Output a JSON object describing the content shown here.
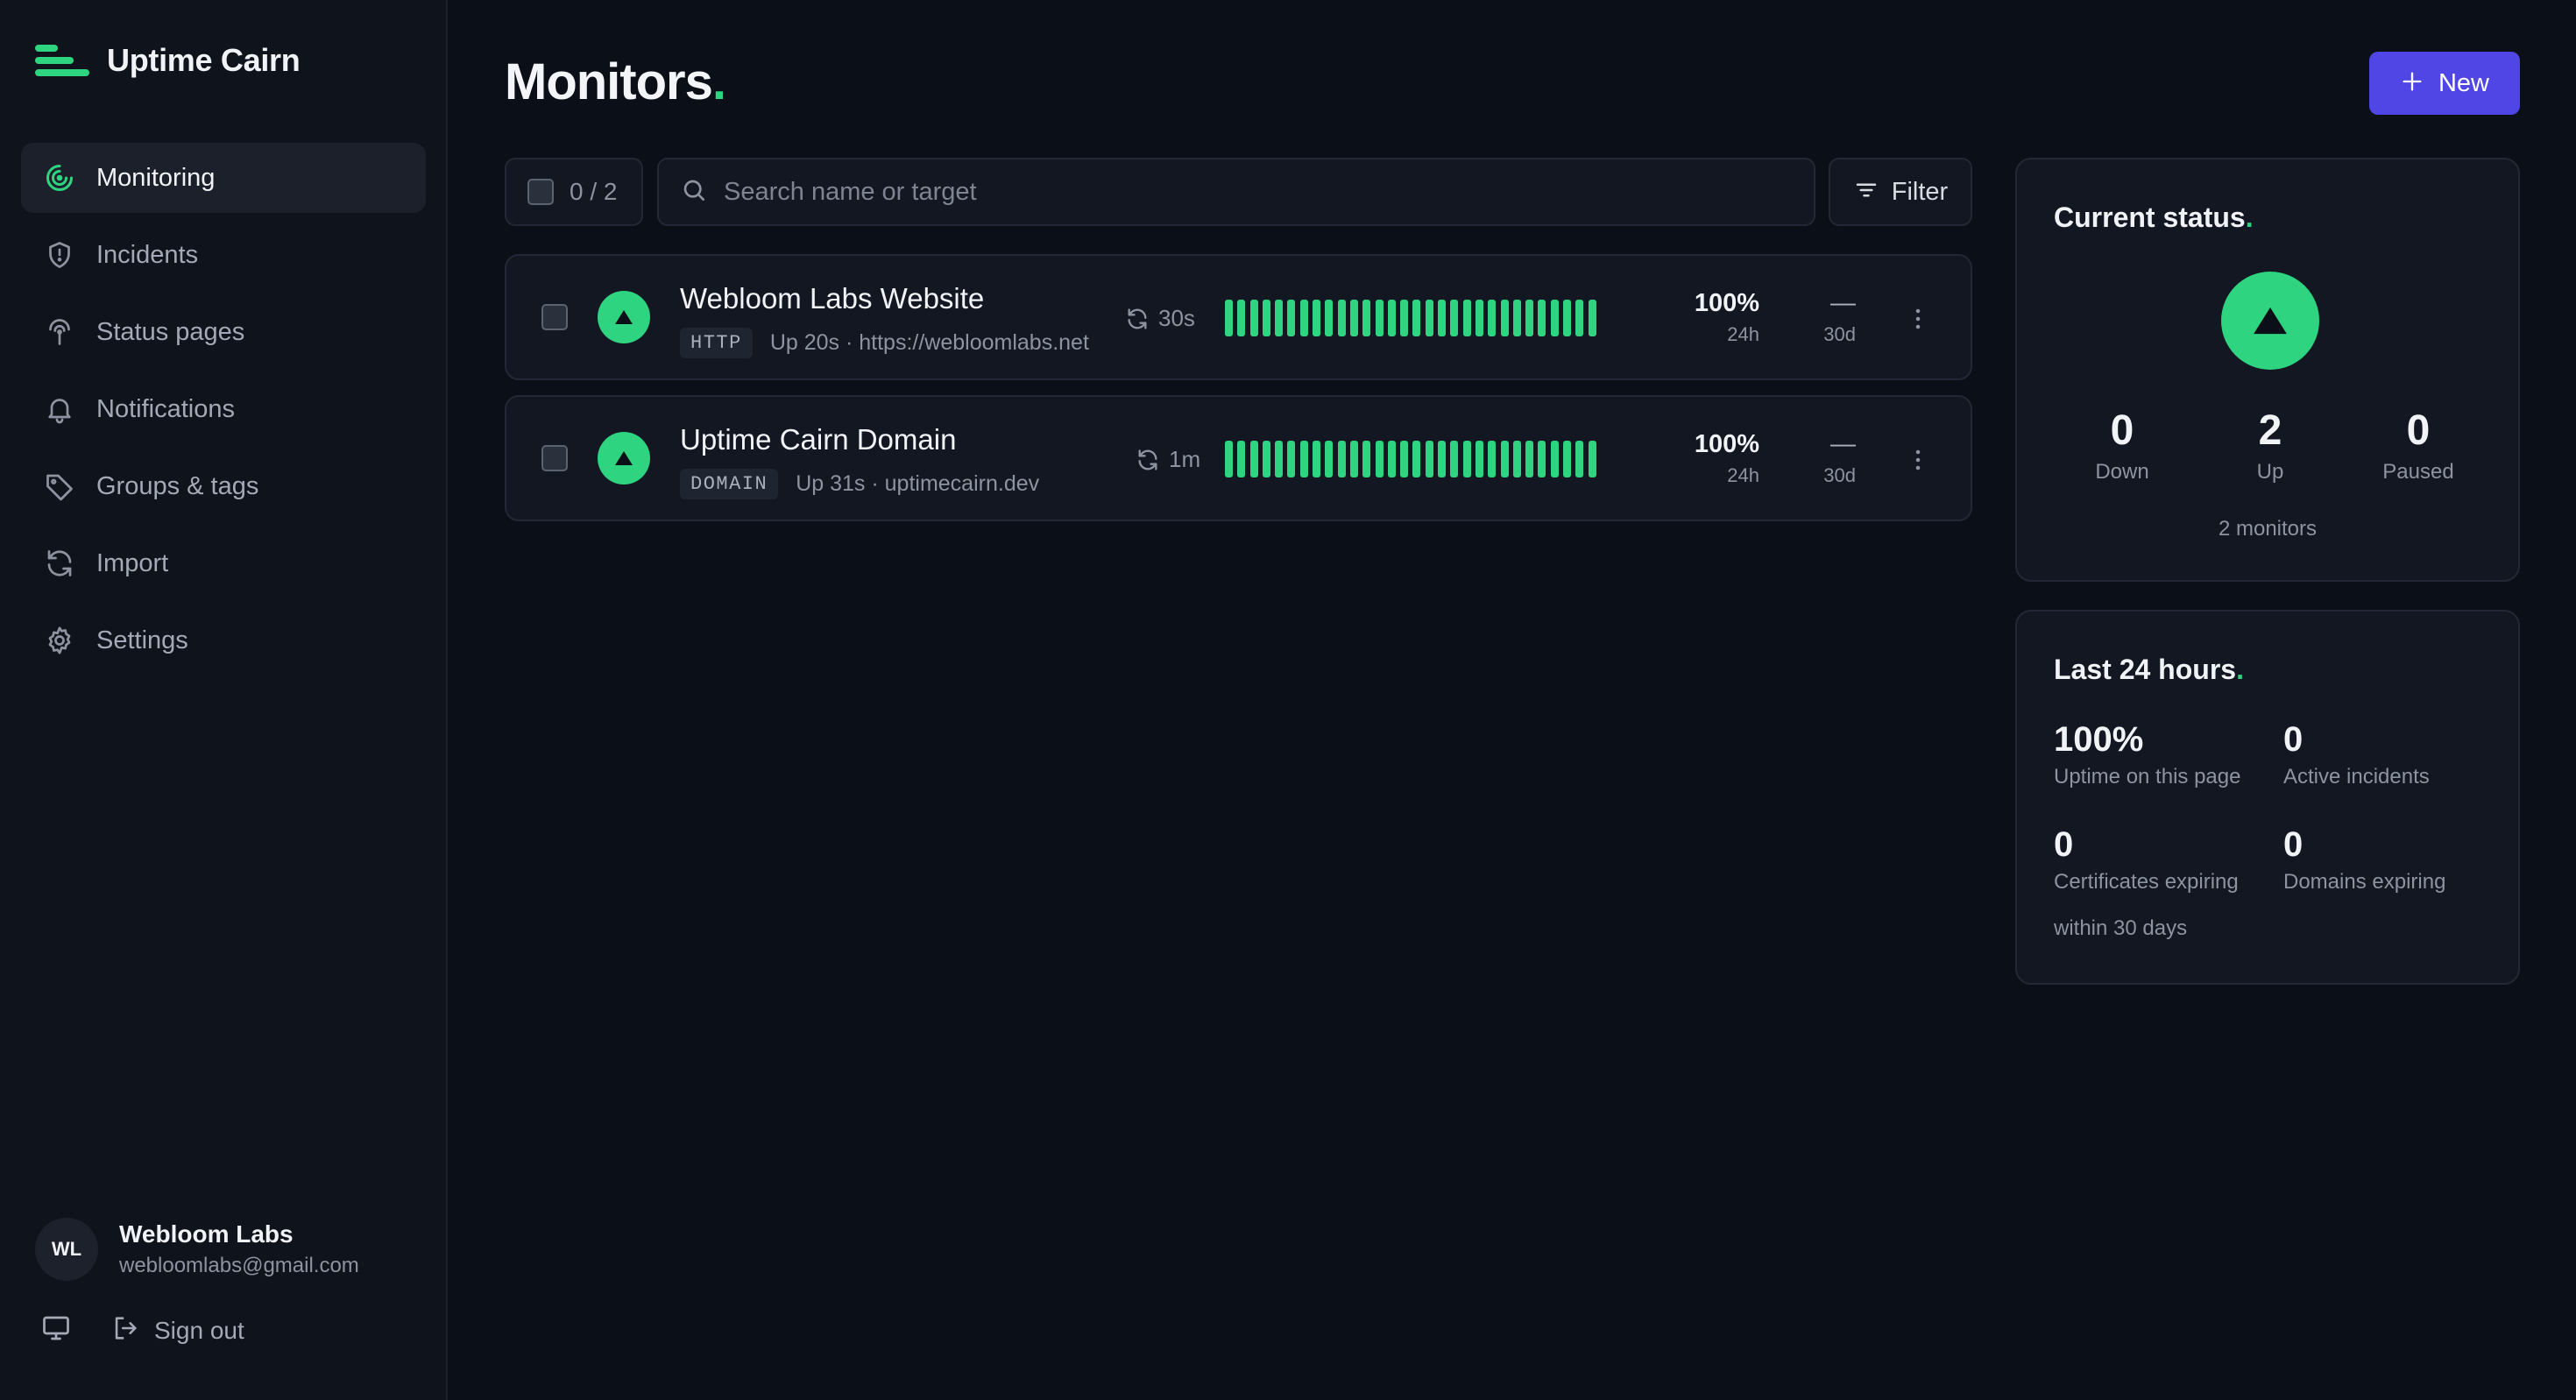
{
  "app": {
    "name": "Uptime Cairn"
  },
  "colors": {
    "accent": "#2fd481",
    "primary_button": "#4f46e5",
    "background": "#0b0f17"
  },
  "sidebar": {
    "items": [
      {
        "label": "Monitoring",
        "icon": "monitoring-icon",
        "active": true
      },
      {
        "label": "Incidents",
        "icon": "shield-icon"
      },
      {
        "label": "Status pages",
        "icon": "broadcast-icon"
      },
      {
        "label": "Notifications",
        "icon": "bell-icon"
      },
      {
        "label": "Groups & tags",
        "icon": "tag-icon"
      },
      {
        "label": "Import",
        "icon": "refresh-icon"
      },
      {
        "label": "Settings",
        "icon": "gear-icon"
      }
    ],
    "account": {
      "initials": "WL",
      "name": "Webloom Labs",
      "email": "webloomlabs@gmail.com"
    },
    "sign_out": "Sign out"
  },
  "main": {
    "title": "Monitors",
    "title_dot": ".",
    "new_button": "New",
    "selection": "0 / 2",
    "search_placeholder": "Search name or target",
    "filter_label": "Filter",
    "monitors": [
      {
        "name": "Webloom Labs Website",
        "type": "HTTP",
        "meta": "Up 20s · https://webloomlabs.net",
        "interval": "30s",
        "uptime_24h": "100%",
        "uptime_24h_label": "24h",
        "uptime_30d": "—",
        "uptime_30d_label": "30d",
        "status": "up"
      },
      {
        "name": "Uptime Cairn Domain",
        "type": "DOMAIN",
        "meta": "Up 31s · uptimecairn.dev",
        "interval": "1m",
        "uptime_24h": "100%",
        "uptime_24h_label": "24h",
        "uptime_30d": "—",
        "uptime_30d_label": "30d",
        "status": "up"
      }
    ]
  },
  "current_status": {
    "title": "Current status",
    "dot": ".",
    "down": "0",
    "down_label": "Down",
    "up": "2",
    "up_label": "Up",
    "paused": "0",
    "paused_label": "Paused",
    "total": "2 monitors"
  },
  "last_24h": {
    "title": "Last 24 hours",
    "dot": ".",
    "uptime": "100%",
    "uptime_label": "Uptime on this page",
    "incidents": "0",
    "incidents_label": "Active incidents",
    "certs": "0",
    "certs_label": "Certificates expiring",
    "domains": "0",
    "domains_label": "Domains expiring",
    "footnote": "within 30 days"
  }
}
